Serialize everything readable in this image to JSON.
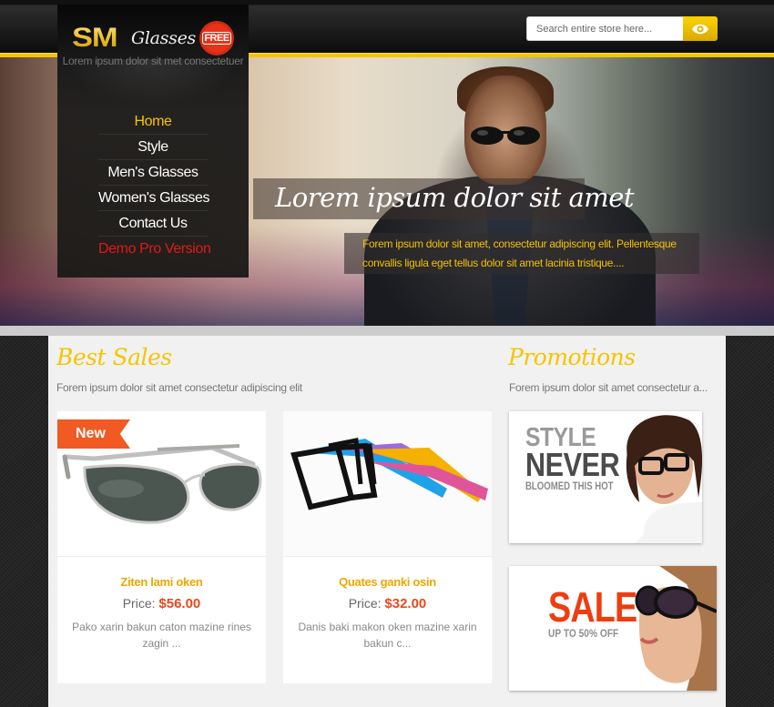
{
  "header": {
    "logo": {
      "brand": "SM",
      "name": "Glasses",
      "badge": "FREE"
    },
    "tagline": "Lorem ipsum dolor sit met consectetuer",
    "search": {
      "placeholder": "Search entire store here...",
      "value": "",
      "button_icon": "eye-icon"
    },
    "colors": {
      "accent": "#f5c400",
      "header_bg": "#111111"
    }
  },
  "nav": {
    "items": [
      {
        "label": "Home",
        "state": "active"
      },
      {
        "label": "Style"
      },
      {
        "label": "Men's Glasses"
      },
      {
        "label": "Women's Glasses"
      },
      {
        "label": "Contact Us"
      },
      {
        "label": "Demo Pro Version",
        "state": "highlight"
      }
    ]
  },
  "hero": {
    "title": "Lorem ipsum dolor sit amet",
    "caption": "Forem ipsum dolor sit amet, consectetur adipiscing elit. Pellentesque convallis ligula eget tellus dolor sit amet lacinia tristique...."
  },
  "best_sales": {
    "title": "Best Sales",
    "subtitle": "Forem ipsum dolor sit amet consectetur adipiscing elit",
    "products": [
      {
        "badge": "New",
        "name": "Ziten lami oken",
        "price_label": "Price:",
        "price": "$56.00",
        "description": "Pako xarin bakun caton mazine rines zagin ...",
        "image": "aviator-sunglasses"
      },
      {
        "name": "Quates ganki osin",
        "price_label": "Price:",
        "price": "$32.00",
        "description": "Danis baki makon oken mazine xarin bakun c...",
        "image": "colorful-frame-glasses"
      }
    ]
  },
  "promotions": {
    "title": "Promotions",
    "subtitle": "Forem ipsum dolor sit amet consectetur a...",
    "banners": [
      {
        "line1": "STYLE",
        "line2": "NEVER",
        "line3": "BLOOMED THIS HOT",
        "image": "man-with-glasses"
      },
      {
        "line1": "SALE",
        "line2": "UP TO 50% OFF",
        "image": "woman-with-sunglasses"
      }
    ]
  },
  "colors": {
    "accent_yellow": "#f5c400",
    "price_red": "#e84a1a",
    "product_name": "#e8a800",
    "badge_orange": "#f15a22",
    "demo_red": "#e01a1a"
  }
}
